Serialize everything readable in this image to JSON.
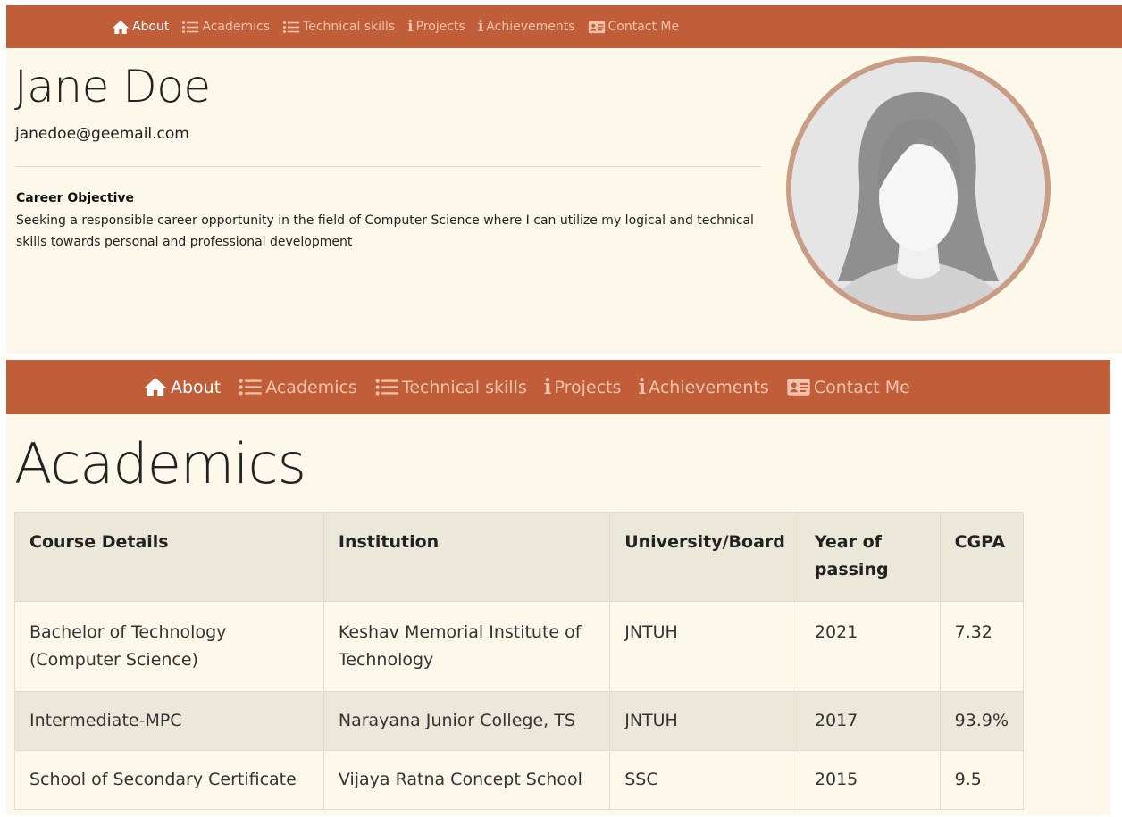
{
  "nav": {
    "items": [
      {
        "label": "About",
        "icon": "home-icon",
        "active": true
      },
      {
        "label": "Academics",
        "icon": "list-icon",
        "active": false
      },
      {
        "label": "Technical skills",
        "icon": "list-icon",
        "active": false
      },
      {
        "label": "Projects",
        "icon": "info-icon",
        "active": false
      },
      {
        "label": "Achievements",
        "icon": "info-icon",
        "active": false
      },
      {
        "label": "Contact Me",
        "icon": "contact-card-icon",
        "active": false
      }
    ]
  },
  "profile": {
    "name": "Jane Doe",
    "email": "janedoe@geemail.com",
    "objective_title": "Career Objective",
    "objective_text": "Seeking a responsible career opportunity in the field of Computer Science where I can utilize my logical and technical skills towards personal and professional development"
  },
  "academics": {
    "title": "Academics",
    "columns": [
      "Course Details",
      "Institution",
      "University/Board",
      "Year of passing",
      "CGPA"
    ],
    "rows": [
      [
        "Bachelor of Technology (Computer Science)",
        "Keshav Memorial Institute of Technology",
        "JNTUH",
        "2021",
        "7.32"
      ],
      [
        "Intermediate-MPC",
        "Narayana Junior College, TS",
        "JNTUH",
        "2017",
        "93.9%"
      ],
      [
        "School of Secondary Certificate",
        "Vijaya Ratna Concept School",
        "SSC",
        "2015",
        "9.5"
      ]
    ]
  },
  "colors": {
    "navbar": "#bf5e38",
    "page_background": "#fcf9ea",
    "nav_text": "#f1c3ae",
    "avatar_ring": "#c99c86"
  }
}
